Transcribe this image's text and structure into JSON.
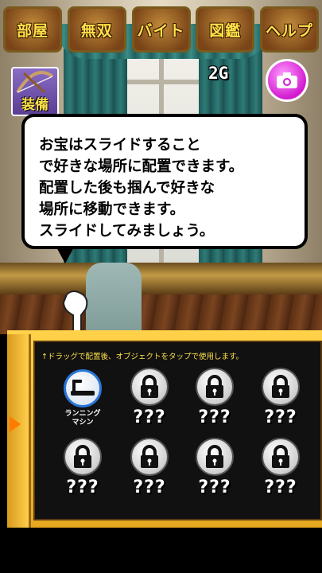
{
  "tabs": [
    "部屋",
    "無双",
    "バイト",
    "図鑑",
    "ヘルプ"
  ],
  "money": "2G",
  "equip_label": "装備",
  "dialog": "お宝はスライドすること\nで好きな場所に配置できます。\n配置した後も掴んで好きな\n場所に移動できます。\nスライドしてみましょう。",
  "panel": {
    "hint": "↑ドラッグで配置後、オブジェクトをタップで使用します。",
    "items": [
      {
        "label": "ランニング\nマシン",
        "locked": false,
        "icon": "treadmill-icon"
      },
      {
        "label": "???",
        "locked": true,
        "icon": "lock-icon"
      },
      {
        "label": "???",
        "locked": true,
        "icon": "lock-icon"
      },
      {
        "label": "???",
        "locked": true,
        "icon": "lock-icon"
      },
      {
        "label": "???",
        "locked": true,
        "icon": "lock-icon"
      },
      {
        "label": "???",
        "locked": true,
        "icon": "lock-icon"
      },
      {
        "label": "???",
        "locked": true,
        "icon": "lock-icon"
      },
      {
        "label": "???",
        "locked": true,
        "icon": "lock-icon"
      }
    ]
  },
  "colors": {
    "tab_text": "#ffe14a",
    "panel": "#ffd24a",
    "active_ring": "#2a75d8",
    "camera": "#d21bd0"
  }
}
